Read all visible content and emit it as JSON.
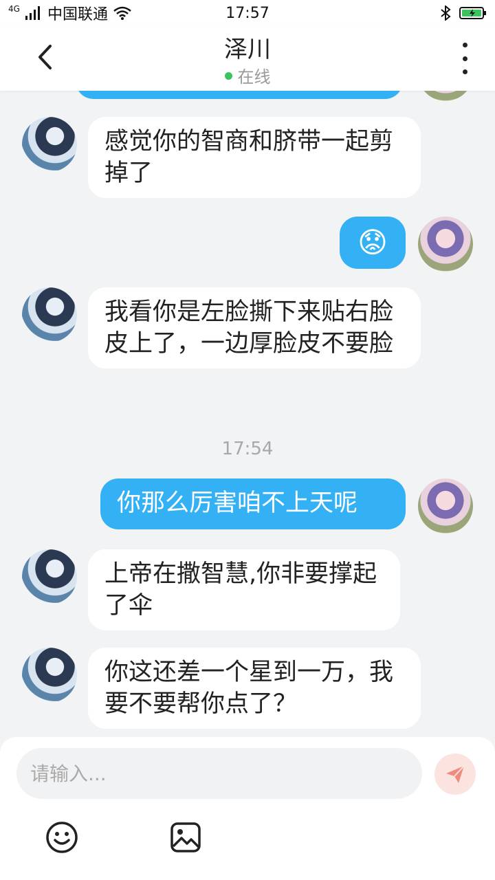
{
  "statusbar": {
    "network_type": "4G",
    "carrier": "中国联通",
    "time": "17:57"
  },
  "header": {
    "title": "泽川",
    "online_status": "在线"
  },
  "messages": [
    {
      "side": "in",
      "text": "感觉你的智商和脐带一起剪掉了"
    },
    {
      "side": "out",
      "emoji": "😟"
    },
    {
      "side": "in",
      "text": "我看你是左脸撕下来贴右脸皮上了，一边厚脸皮不要脸"
    },
    {
      "timestamp": "17:54"
    },
    {
      "side": "out",
      "text": "你那么厉害咱不上天呢"
    },
    {
      "side": "in",
      "text": "上帝在撒智慧,你非要撑起了伞"
    },
    {
      "side": "in",
      "text": "你这还差一个星到一万，我要不要帮你点了？"
    }
  ],
  "composer": {
    "placeholder": "请输入..."
  },
  "icons": {
    "back": "chevron-left-icon",
    "more": "more-vertical-icon",
    "send": "send-icon",
    "emoji": "emoji-icon",
    "image": "image-icon"
  },
  "colors": {
    "accent": "#34b1f4",
    "online": "#3cc35f",
    "background": "#f2f3f5"
  }
}
